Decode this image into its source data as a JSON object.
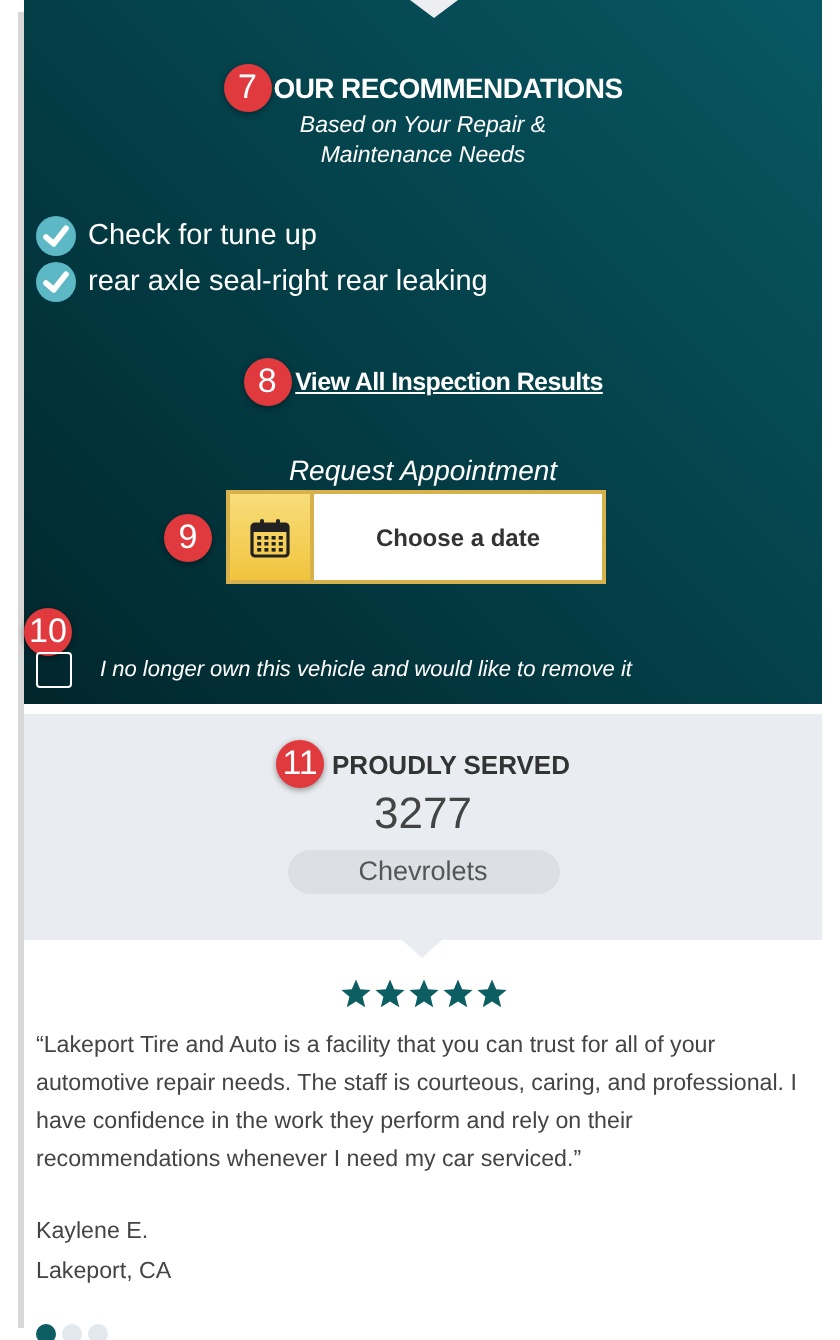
{
  "recommendations": {
    "badge": "7",
    "title": "OUR RECOMMENDATIONS",
    "subtitle": "Based on Your Repair & Maintenance Needs",
    "items": [
      {
        "label": "Check for tune up",
        "checked": true
      },
      {
        "label": "rear axle seal-right rear leaking",
        "checked": true
      }
    ],
    "link": {
      "badge": "8",
      "label": "View All Inspection Results"
    }
  },
  "appointment": {
    "label": "Request Appointment",
    "badge": "9",
    "button": "Choose a date"
  },
  "remove_vehicle": {
    "badge": "10",
    "label": "I no longer own this vehicle and would like to remove it",
    "checked": false
  },
  "proudly_served": {
    "badge": "11",
    "title": "PROUDLY SERVED",
    "count": "3277",
    "make": "Chevrolets"
  },
  "testimonial": {
    "stars": 5,
    "quote": "“Lakeport Tire and Auto is a facility that you can trust for all of your automotive repair needs. The staff is courteous, caring, and professional. I have confidence in the work they perform and rely on their recommendations whenever I need my car serviced.”",
    "author": "Kaylene E.",
    "location": "Lakeport, CA",
    "dots": [
      {
        "selected": true
      },
      {
        "selected": false
      },
      {
        "selected": false
      }
    ]
  }
}
